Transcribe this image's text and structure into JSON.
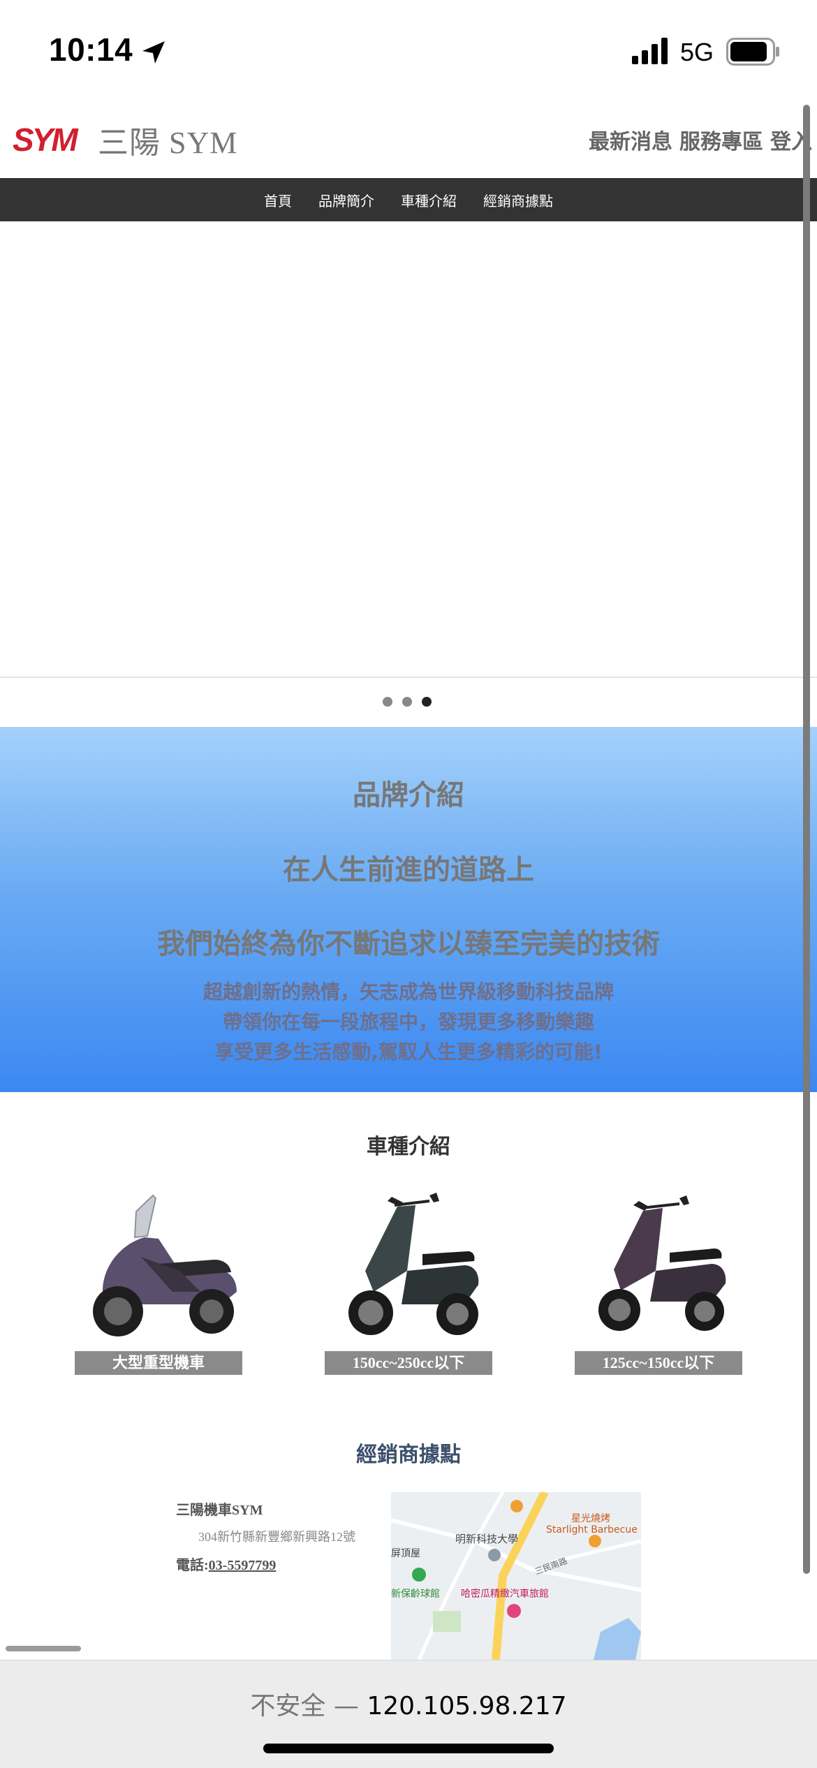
{
  "status_bar": {
    "time": "10:14",
    "network": "5G",
    "icons": [
      "location-arrow-icon",
      "signal-icon",
      "battery-icon"
    ]
  },
  "header": {
    "logo_text": "SYM",
    "title": "三陽 SYM",
    "top_links": [
      "最新消息",
      "服務專區",
      "登入"
    ]
  },
  "nav": {
    "items": [
      "首頁",
      "品牌簡介",
      "車種介紹",
      "經銷商據點"
    ]
  },
  "carousel": {
    "slide_count": 3,
    "active_index": 2
  },
  "brand": {
    "heading": "品牌介紹",
    "line1": "在人生前進的道路上",
    "line2": "我們始終為你不斷追求以臻至完美的技術",
    "paragraph": [
      "超越創新的熱情，矢志成為世界級移動科技品牌",
      "帶領你在每一段旅程中，發現更多移動樂趣",
      "享受更多生活感動,駕馭人生更多精彩的可能!"
    ]
  },
  "models": {
    "title": "車種介紹",
    "items": [
      {
        "label": "大型重型機車"
      },
      {
        "label": "150cc~250cc以下"
      },
      {
        "label": "125cc~150cc以下"
      }
    ]
  },
  "dealers": {
    "title": "經銷商據點",
    "name": "三陽機車SYM",
    "address": "304新竹縣新豐鄉新興路12號",
    "phone_prefix": "電話:",
    "phone": "03-5597799",
    "map_labels": {
      "university": "明新科技大學",
      "bbq_cn": "星光燒烤",
      "bbq_en": "Starlight Barbecue",
      "house": "屏頂屋",
      "bowling": "新保齡球館",
      "motel": "哈密瓜精緻汽車旅館",
      "road": "三民南路"
    }
  },
  "browser": {
    "not_secure": "不安全",
    "separator": " — ",
    "host": "120.105.98.217"
  },
  "colors": {
    "nav_bg": "#333333",
    "brand_gradient_top": "#a5d1fb",
    "brand_gradient_bottom": "#3b88f2",
    "logo_red": "#d0202e"
  }
}
